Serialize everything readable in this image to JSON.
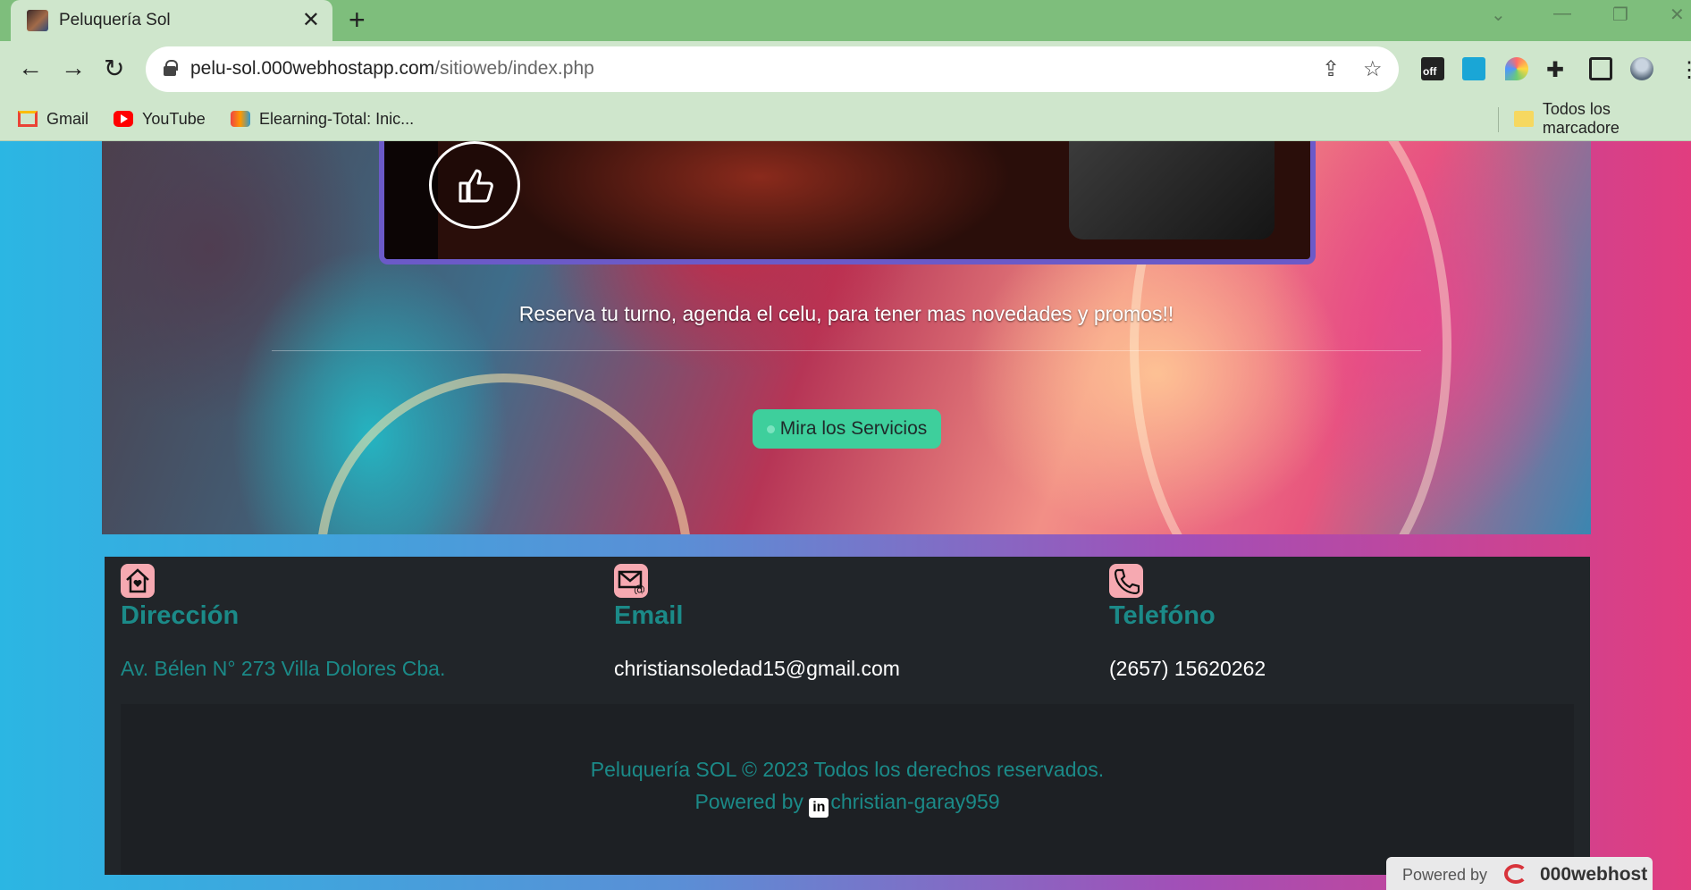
{
  "browser": {
    "tab_title": "Peluquería Sol",
    "url_host": "pelu-sol.000webhostapp.com",
    "url_path": "/sitioweb/index.php",
    "extension_badge": "off",
    "bookmarks": [
      "Gmail",
      "YouTube",
      "Elearning-Total: Inic..."
    ],
    "all_bookmarks": "Todos los marcadore"
  },
  "hero": {
    "tagline": "Reserva tu turno, agenda el celu, para tener mas novedades y promos!!",
    "services_button": "Mira los Servicios"
  },
  "footer": {
    "columns": [
      {
        "title": "Dirección",
        "value": "Av. Bélen N° 273 Villa Dolores Cba.",
        "icon": "home-icon"
      },
      {
        "title": "Email",
        "value": "christiansoledad15@gmail.com",
        "icon": "mail-icon"
      },
      {
        "title": "Telefóno",
        "value": "(2657) 15620262",
        "icon": "phone-icon"
      }
    ],
    "copyright": "Peluquería SOL © 2023 Todos los derechos reservados.",
    "powered_prefix": "Powered by ",
    "linkedin_glyph": "in",
    "author": "christian-garay959"
  },
  "badge": {
    "label": "Powered by",
    "brand": "000webhost"
  },
  "colors": {
    "accent_teal": "#1b8a88",
    "button_green": "#3ecf9c",
    "footer_bg": "#212529",
    "tab_green": "#7ebe7c"
  }
}
